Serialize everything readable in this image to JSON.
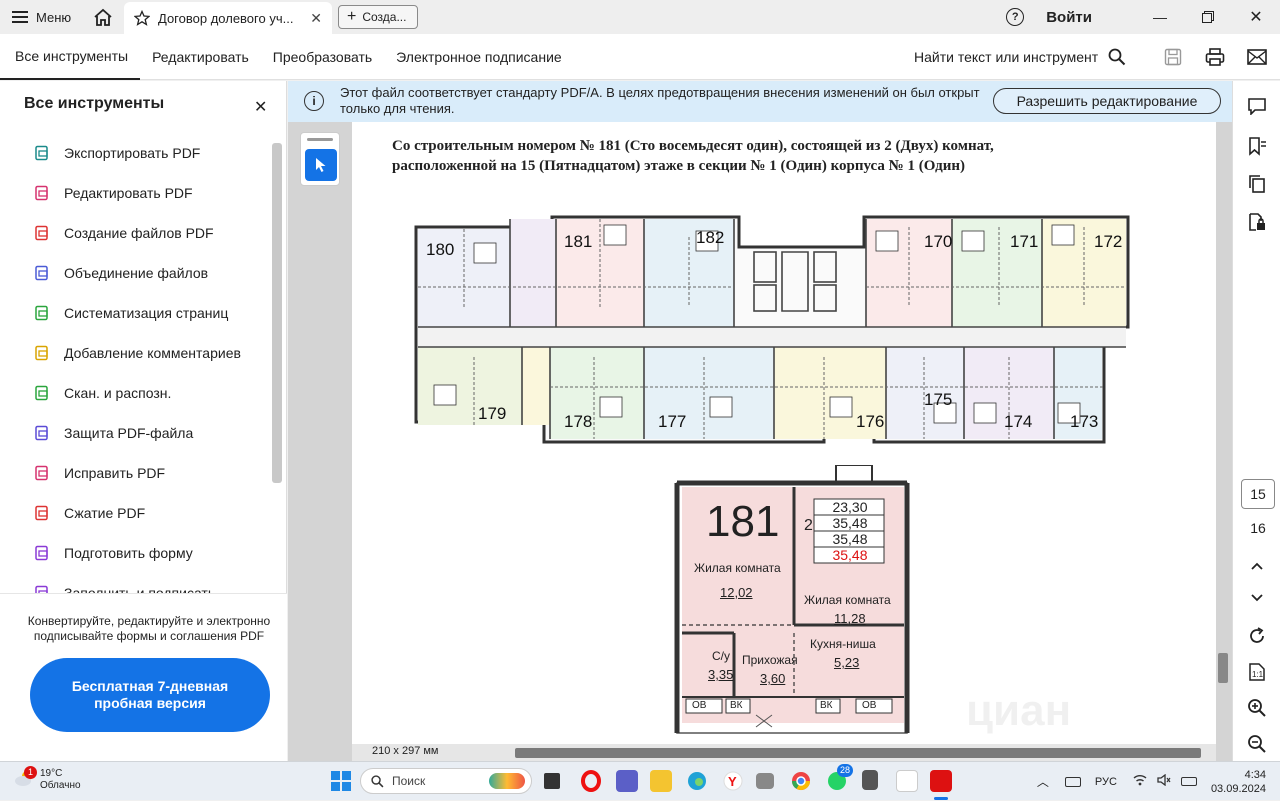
{
  "titlebar": {
    "menu_label": "Меню",
    "tab_title": "Договор долевого уч...",
    "new_tab_label": "Созда...",
    "signin_label": "Войти"
  },
  "toolbar": {
    "tabs": [
      "Все инструменты",
      "Редактировать",
      "Преобразовать",
      "Электронное подписание"
    ],
    "find_label": "Найти текст или инструмент"
  },
  "left_panel": {
    "title": "Все инструменты",
    "items": [
      {
        "label": "Экспортировать PDF",
        "icon": "export-pdf-icon",
        "color": "#1a8a8a"
      },
      {
        "label": "Редактировать PDF",
        "icon": "edit-pdf-icon",
        "color": "#d6326f"
      },
      {
        "label": "Создание файлов PDF",
        "icon": "create-pdf-icon",
        "color": "#d33"
      },
      {
        "label": "Объединение файлов",
        "icon": "combine-files-icon",
        "color": "#4b5bd6"
      },
      {
        "label": "Систематизация страниц",
        "icon": "organize-pages-icon",
        "color": "#2aa53d"
      },
      {
        "label": "Добавление комментариев",
        "icon": "comment-icon",
        "color": "#d9a400"
      },
      {
        "label": "Скан. и распозн.",
        "icon": "scan-icon",
        "color": "#2aa53d"
      },
      {
        "label": "Защита PDF-файла",
        "icon": "protect-icon",
        "color": "#5b4bd6"
      },
      {
        "label": "Исправить PDF",
        "icon": "redact-icon",
        "color": "#d6326f"
      },
      {
        "label": "Сжатие PDF",
        "icon": "compress-icon",
        "color": "#d33"
      },
      {
        "label": "Подготовить форму",
        "icon": "form-icon",
        "color": "#8a3ad6"
      },
      {
        "label": "Заполнить и подписать",
        "icon": "fill-sign-icon",
        "color": "#8a3ad6"
      }
    ],
    "promo_text": "Конвертируйте, редактируйте и электронно подписывайте формы и соглашения PDF",
    "cta_label": "Бесплатная 7-дневная пробная версия"
  },
  "banner": {
    "message": "Этот файл соответствует стандарту PDF/A. В целях предотвращения внесения изменений он был открыт только для чтения.",
    "button_label": "Разрешить редактирование"
  },
  "document": {
    "title_line1": "Со строительным номером № 181 (Сто восемьдесят один), состоящей из 2 (Двух) комнат,",
    "title_line2": "расположенной на 15 (Пятнадцатом) этаже в секции № 1 (Один) корпуса № 1 (Один)",
    "page_size_label": "210 x 297 мм",
    "plan": {
      "units_top": [
        "180",
        "181",
        "182",
        "170",
        "171",
        "172"
      ],
      "units_bottom": [
        "179",
        "178",
        "177",
        "176",
        "175",
        "174",
        "173"
      ]
    },
    "detail": {
      "apartment_number": "181",
      "rooms_count": "2",
      "areas": [
        "23,30",
        "35,48",
        "35,48",
        "35,48"
      ],
      "area_highlight_color": "#d11",
      "rooms": [
        {
          "name": "Жилая комната",
          "area": "12,02"
        },
        {
          "name": "Жилая комната",
          "area": "11,28"
        },
        {
          "name": "С/у",
          "area": "3,35"
        },
        {
          "name": "Прихожая",
          "area": "3,60"
        },
        {
          "name": "Кухня-ниша",
          "area": "5,23"
        }
      ],
      "labels_ov_vk": [
        "ОВ",
        "ВК",
        "ВК",
        "ОВ"
      ],
      "watermark": "циан"
    }
  },
  "right_rail": {
    "page_current": "15",
    "page_next": "16"
  },
  "taskbar": {
    "weather_temp": "19°C",
    "weather_text": "Облачно",
    "weather_badge": "1",
    "search_placeholder": "Поиск",
    "whatsapp_badge": "28",
    "lang": "РУС",
    "time": "4:34",
    "date": "03.09.2024"
  }
}
